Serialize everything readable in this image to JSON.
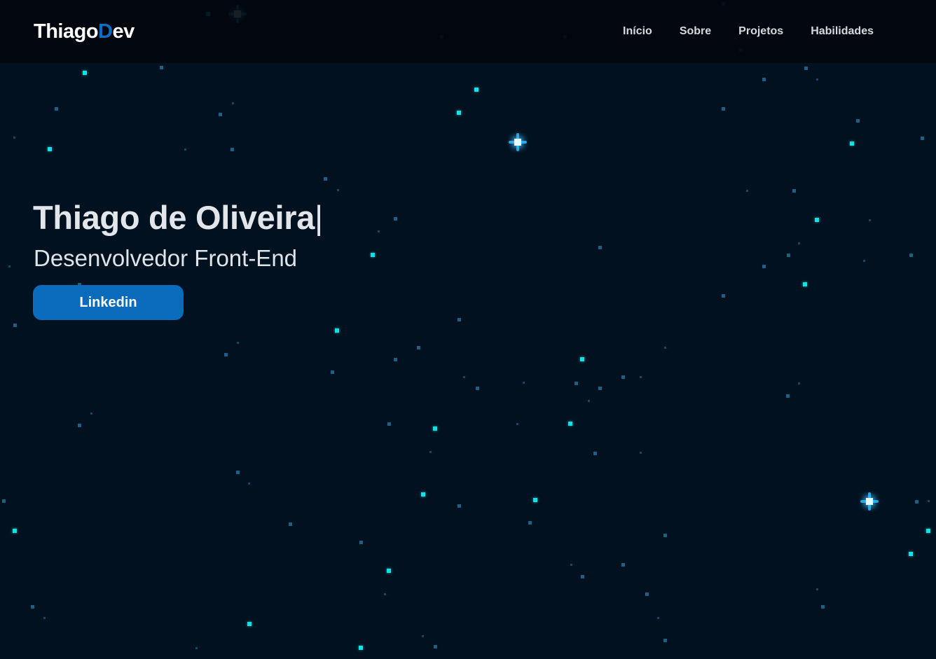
{
  "header": {
    "logo": {
      "part1": "Thiago",
      "accent": "D",
      "part2": "ev"
    },
    "nav": [
      {
        "label": "Início"
      },
      {
        "label": "Sobre"
      },
      {
        "label": "Projetos"
      },
      {
        "label": "Habilidades"
      }
    ]
  },
  "hero": {
    "title": "Thiago de Oliveira",
    "cursor": "|",
    "subtitle": "Desenvolvedor Front-End",
    "button_label": "Linkedin"
  },
  "colors": {
    "background": "#01111f",
    "header_background": "#02060c",
    "accent": "#0d6fc4",
    "button": "#0a6bbd",
    "star": "#0ee3e8"
  }
}
